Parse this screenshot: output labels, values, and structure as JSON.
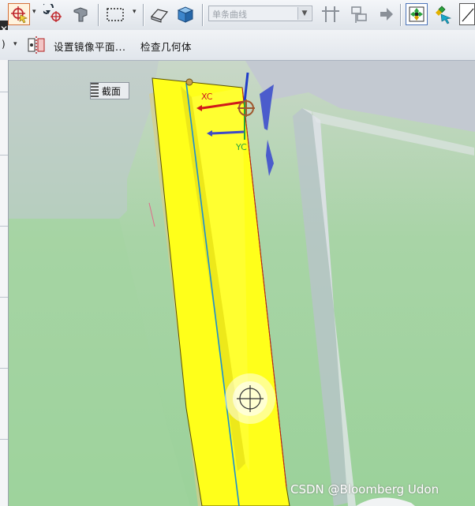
{
  "toolbar": {
    "combo_value": "单条曲线",
    "combo_arrow": "▼",
    "dropdown_glyph": "▾"
  },
  "toolbar2": {
    "partial_text": ")",
    "mirror_plane_label": "设置镜像平面...",
    "check_geometry_label": "检查几何体"
  },
  "panel": {
    "close_glyph": "✕"
  },
  "viewport": {
    "section_label": "截面",
    "axis_yc": "YC",
    "axis_xc": "XC",
    "watermark": "CSDN @Bloomberg Udon",
    "colors": {
      "background": "#9bd29a",
      "part": "#ffff1a",
      "surface": "#c6cdd6",
      "edge_line": "#1a8fd0",
      "axis_x": "#d01a1a",
      "axis_y": "#1f3cc8",
      "axis_z": "#1f3cc8"
    }
  }
}
